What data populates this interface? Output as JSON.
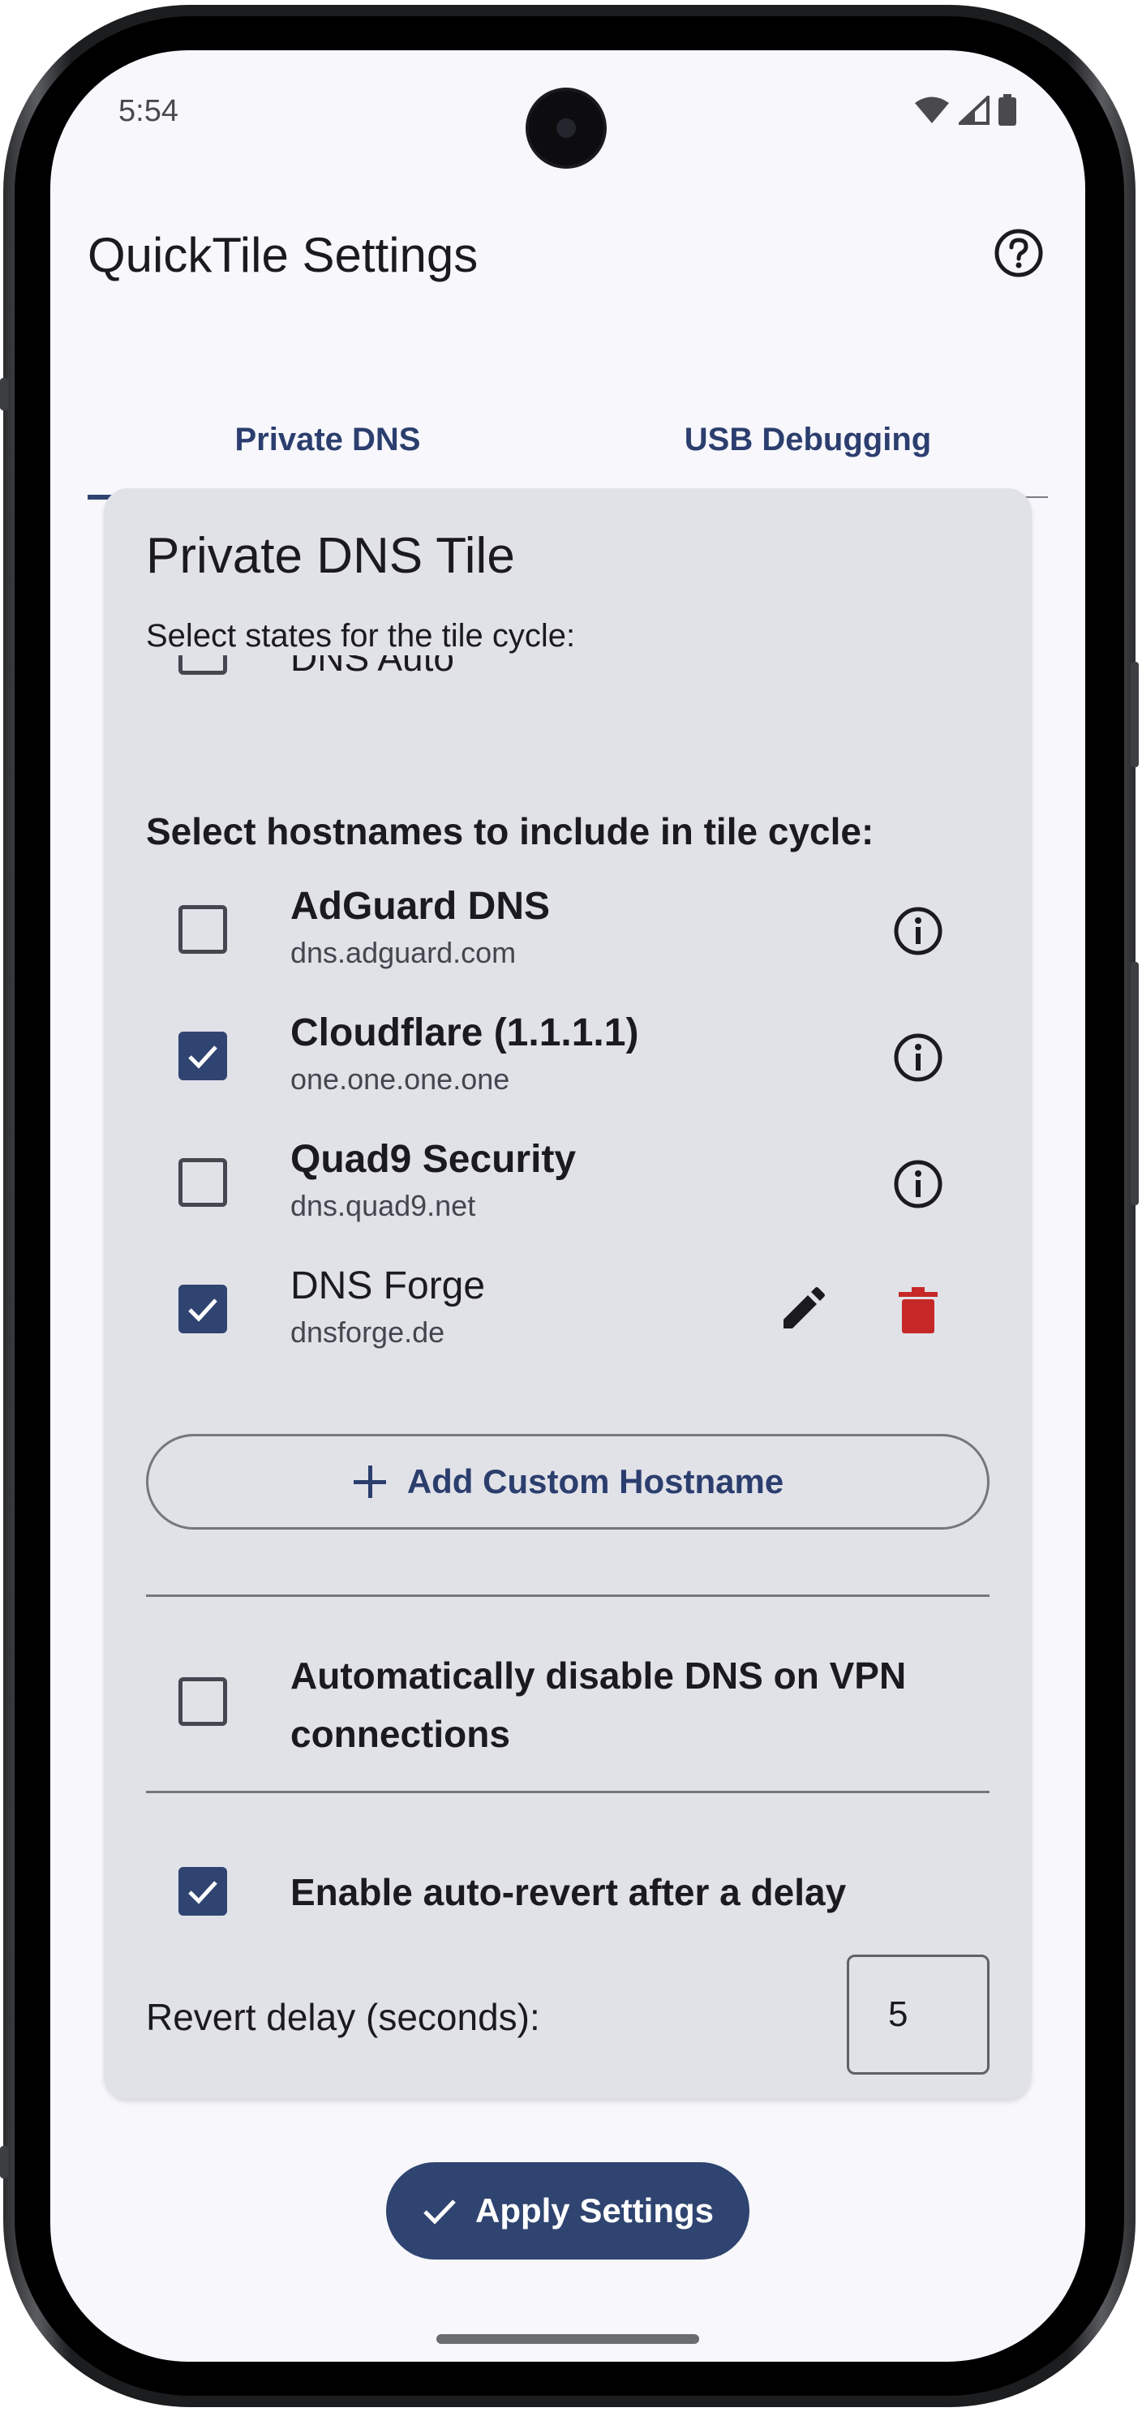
{
  "status_bar": {
    "time": "5:54"
  },
  "app_bar": {
    "title": "QuickTile Settings",
    "help_icon": "help-circle-icon"
  },
  "tabs": [
    {
      "label": "Private DNS",
      "selected": true
    },
    {
      "label": "USB Debugging",
      "selected": false
    }
  ],
  "card": {
    "title": "Private DNS Tile",
    "subtitle": "Select states for the tile cycle:",
    "partial_state": {
      "label": "DNS Auto",
      "checked": false
    },
    "hostnames_label": "Select hostnames to include in tile cycle:",
    "hostnames": [
      {
        "name": "AdGuard DNS",
        "host": "dns.adguard.com",
        "checked": false,
        "bold": true
      },
      {
        "name": "Cloudflare (1.1.1.1)",
        "host": "one.one.one.one",
        "checked": true,
        "bold": true
      },
      {
        "name": "Quad9 Security",
        "host": "dns.quad9.net",
        "checked": false,
        "bold": true
      },
      {
        "name": "DNS Forge",
        "host": "dnsforge.de",
        "checked": true,
        "bold": false
      }
    ],
    "add_button": "Add Custom Hostname",
    "vpn_label": "Automatically disable DNS on VPN connections",
    "vpn_checked": false,
    "revert_label": "Enable auto-revert after a delay",
    "revert_checked": true,
    "delay_label": "Revert delay (seconds):",
    "delay_value": "5"
  },
  "apply_button": "Apply Settings",
  "colors": {
    "primary": "#2f4470",
    "delete": "#c62828",
    "card_bg": "#e1e2e8",
    "screen_bg": "#f7f7fc"
  }
}
